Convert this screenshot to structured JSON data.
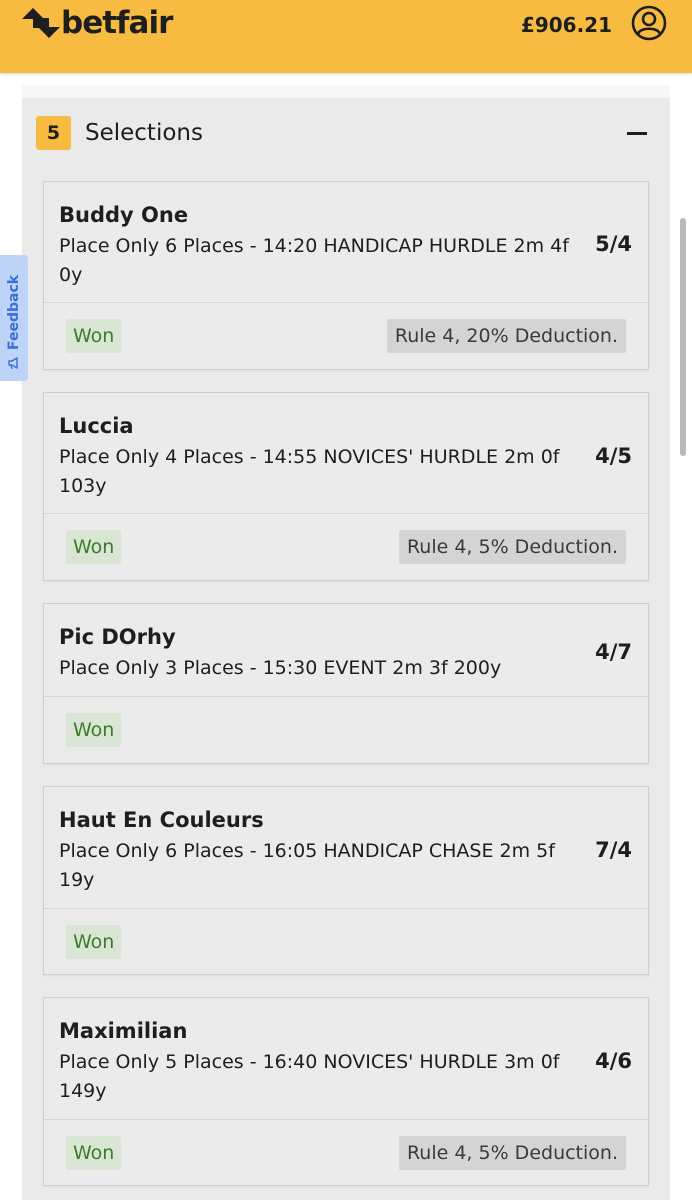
{
  "header": {
    "brand": "betfair",
    "balance": "£906.21",
    "account_icon": "user-circle-icon",
    "color": "#f6bb40"
  },
  "feedback": {
    "label": "Feedback",
    "icon": "megaphone-icon"
  },
  "panel": {
    "count": "5",
    "title": "Selections",
    "collapse_icon": "minus-icon"
  },
  "selections": [
    {
      "name": "Buddy One",
      "description": "Place Only 6 Places - 14:20 HANDICAP HURDLE 2m 4f 0y",
      "odds": "5/4",
      "status": "Won",
      "rule": "Rule 4, 20% Deduction."
    },
    {
      "name": "Luccia",
      "description": "Place Only 4 Places - 14:55 NOVICES' HURDLE 2m 0f 103y",
      "odds": "4/5",
      "status": "Won",
      "rule": "Rule 4, 5% Deduction."
    },
    {
      "name": "Pic DOrhy",
      "description": "Place Only 3 Places - 15:30 EVENT 2m 3f 200y",
      "odds": "4/7",
      "status": "Won",
      "rule": ""
    },
    {
      "name": "Haut En Couleurs",
      "description": "Place Only 6 Places - 16:05 HANDICAP CHASE 2m 5f 19y",
      "odds": "7/4",
      "status": "Won",
      "rule": ""
    },
    {
      "name": "Maximilian",
      "description": "Place Only 5 Places - 16:40 NOVICES' HURDLE 3m 0f 149y",
      "odds": "4/6",
      "status": "Won",
      "rule": "Rule 4, 5% Deduction."
    }
  ]
}
